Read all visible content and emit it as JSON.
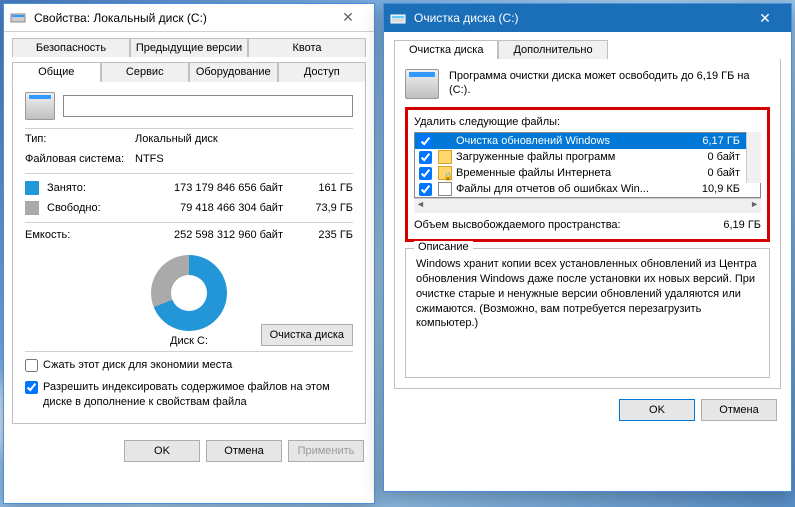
{
  "properties": {
    "title": "Свойства: Локальный диск (C:)",
    "tabs_row1": [
      "Безопасность",
      "Предыдущие версии",
      "Квота"
    ],
    "tabs_row2": [
      "Общие",
      "Сервис",
      "Оборудование",
      "Доступ"
    ],
    "drive_name": "",
    "type_label": "Тип:",
    "type_value": "Локальный диск",
    "fs_label": "Файловая система:",
    "fs_value": "NTFS",
    "used_label": "Занято:",
    "used_bytes": "173 179 846 656 байт",
    "used_gb": "161 ГБ",
    "free_label": "Свободно:",
    "free_bytes": "79 418 466 304 байт",
    "free_gb": "73,9 ГБ",
    "capacity_label": "Емкость:",
    "capacity_bytes": "252 598 312 960 байт",
    "capacity_gb": "235 ГБ",
    "disk_label": "Диск C:",
    "cleanup_button": "Очистка диска",
    "compress_label": "Сжать этот диск для экономии места",
    "index_label": "Разрешить индексировать содержимое файлов на этом диске в дополнение к свойствам файла",
    "ok": "OK",
    "cancel": "Отмена",
    "apply": "Применить"
  },
  "cleanup": {
    "title": "Очистка диска  (C:)",
    "tabs": [
      "Очистка диска",
      "Дополнительно"
    ],
    "intro": "Программа очистки диска может освободить до 6,19 ГБ на  (C:).",
    "delete_label": "Удалить следующие файлы:",
    "files": [
      {
        "name": "Очистка обновлений Windows",
        "size": "6,17 ГБ",
        "checked": true,
        "selected": true,
        "icon": "win"
      },
      {
        "name": "Загруженные файлы программ",
        "size": "0 байт",
        "checked": true,
        "selected": false,
        "icon": "folder"
      },
      {
        "name": "Временные файлы Интернета",
        "size": "0 байт",
        "checked": true,
        "selected": false,
        "icon": "folder-lock"
      },
      {
        "name": "Файлы для отчетов об ошибках Win...",
        "size": "10,9 КБ",
        "checked": true,
        "selected": false,
        "icon": "file"
      }
    ],
    "space_label": "Объем высвобождаемого пространства:",
    "space_value": "6,19 ГБ",
    "desc_title": "Описание",
    "desc_text": "Windows хранит копии всех установленных обновлений из Центра обновления Windows даже после установки их новых версий. При очистке старые и ненужные версии обновлений удаляются или сжимаются. (Возможно, вам потребуется перезагрузить компьютер.)",
    "ok": "OK",
    "cancel": "Отмена"
  }
}
